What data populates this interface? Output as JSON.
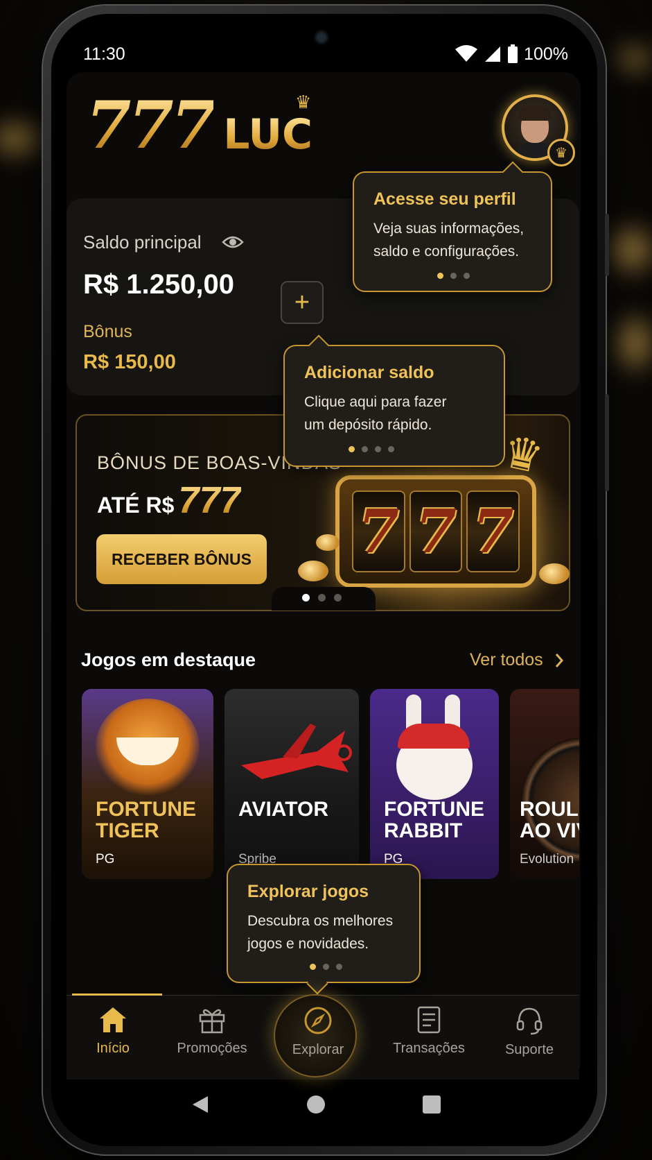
{
  "status_bar": {
    "time": "11:30",
    "battery": "100%"
  },
  "header": {
    "logo_number": "777",
    "logo_word": "LUC"
  },
  "balance": {
    "main_label": "Saldo principal",
    "main_value": "R$ 1.250,00",
    "bonus_label": "Bônus",
    "bonus_value": "R$ 150,00",
    "add_symbol": "+"
  },
  "banner": {
    "title": "BÔNUS DE BOAS-VINDAS",
    "subtitle_prefix": "ATÉ R$",
    "subtitle_amount": "777",
    "button_label": "RECEBER BÔNUS",
    "reels": [
      "7",
      "7",
      "7"
    ],
    "active_slide": 1,
    "slide_count": 3
  },
  "games_section": {
    "title": "Jogos em destaque",
    "see_all": "Ver todos",
    "games": [
      {
        "title_line1": "FORTUNE",
        "title_line2": "TIGER",
        "provider": "PG"
      },
      {
        "title_line1": "AVIATOR",
        "title_line2": "",
        "provider": "Spribe"
      },
      {
        "title_line1": "FORTUNE",
        "title_line2": "RABBIT",
        "provider": "PG"
      },
      {
        "title_line1": "ROULE",
        "title_line2": "AO VIV",
        "provider": "Evolution"
      }
    ]
  },
  "tooltips": {
    "profile": {
      "title": "Acesse seu perfil",
      "line1": "Veja suas informações,",
      "line2": "saldo e configurações."
    },
    "deposit": {
      "title": "Adicionar saldo",
      "line1": "Clique aqui para fazer",
      "line2": "um depósito rápido."
    },
    "explore": {
      "title": "Explorar jogos",
      "line1": "Descubra os melhores",
      "line2": "jogos e novidades."
    }
  },
  "nav": {
    "items": [
      {
        "label": "Início",
        "icon": "home-icon",
        "active": true
      },
      {
        "label": "Promoções",
        "icon": "gift-icon",
        "active": false
      },
      {
        "label": "Explorar",
        "icon": "compass-icon",
        "active": false
      },
      {
        "label": "Transações",
        "icon": "receipt-icon",
        "active": false
      },
      {
        "label": "Suporte",
        "icon": "headset-icon",
        "active": false
      }
    ]
  },
  "colors": {
    "accent_gold": "#e8b94b",
    "background": "#0b0a09",
    "card": "#161512"
  }
}
